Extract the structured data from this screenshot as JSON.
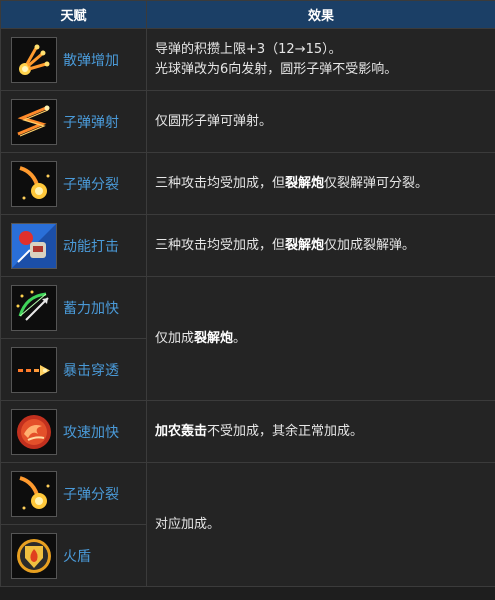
{
  "header": {
    "col_talent": "天赋",
    "col_effect": "效果"
  },
  "rows": [
    {
      "talent": "散弹增加",
      "icon": "scatter-shot-icon",
      "effect_line1": "导弹的积攒上限+3（12→15）。",
      "effect_line2": "光球弹改为6向发射，圆形子弹不受影响。"
    },
    {
      "talent": "子弹弹射",
      "icon": "bullet-bounce-icon",
      "effect": "仅圆形子弹可弹射。"
    },
    {
      "talent": "子弹分裂",
      "icon": "bullet-split-icon",
      "effect_pre": "三种攻击均受加成，但",
      "effect_bold": "裂解炮",
      "effect_post": "仅裂解弹可分裂。"
    },
    {
      "talent": "动能打击",
      "icon": "kinetic-strike-icon",
      "effect_pre": "三种攻击均受加成，但",
      "effect_bold": "裂解炮",
      "effect_post": "仅加成裂解弹。"
    },
    {
      "talent": "蓄力加快",
      "icon": "bow-charge-icon"
    },
    {
      "talent": "暴击穿透",
      "icon": "crit-pierce-icon"
    },
    {
      "talent": "攻速加快",
      "icon": "attack-speed-icon",
      "effect_bold": "加农轰击",
      "effect_post": "不受加成，其余正常加成。"
    },
    {
      "talent": "子弹分裂",
      "icon": "bullet-split-icon"
    },
    {
      "talent": "火盾",
      "icon": "fire-shield-icon"
    }
  ],
  "merged": {
    "charge_crit_pre": "仅加成",
    "charge_crit_bold": "裂解炮",
    "charge_crit_post": "。",
    "split_shield": "对应加成。"
  },
  "colors": {
    "header_bg": "#1b3f66",
    "talent_text": "#4a9ad8",
    "border": "#3b3b3b"
  }
}
